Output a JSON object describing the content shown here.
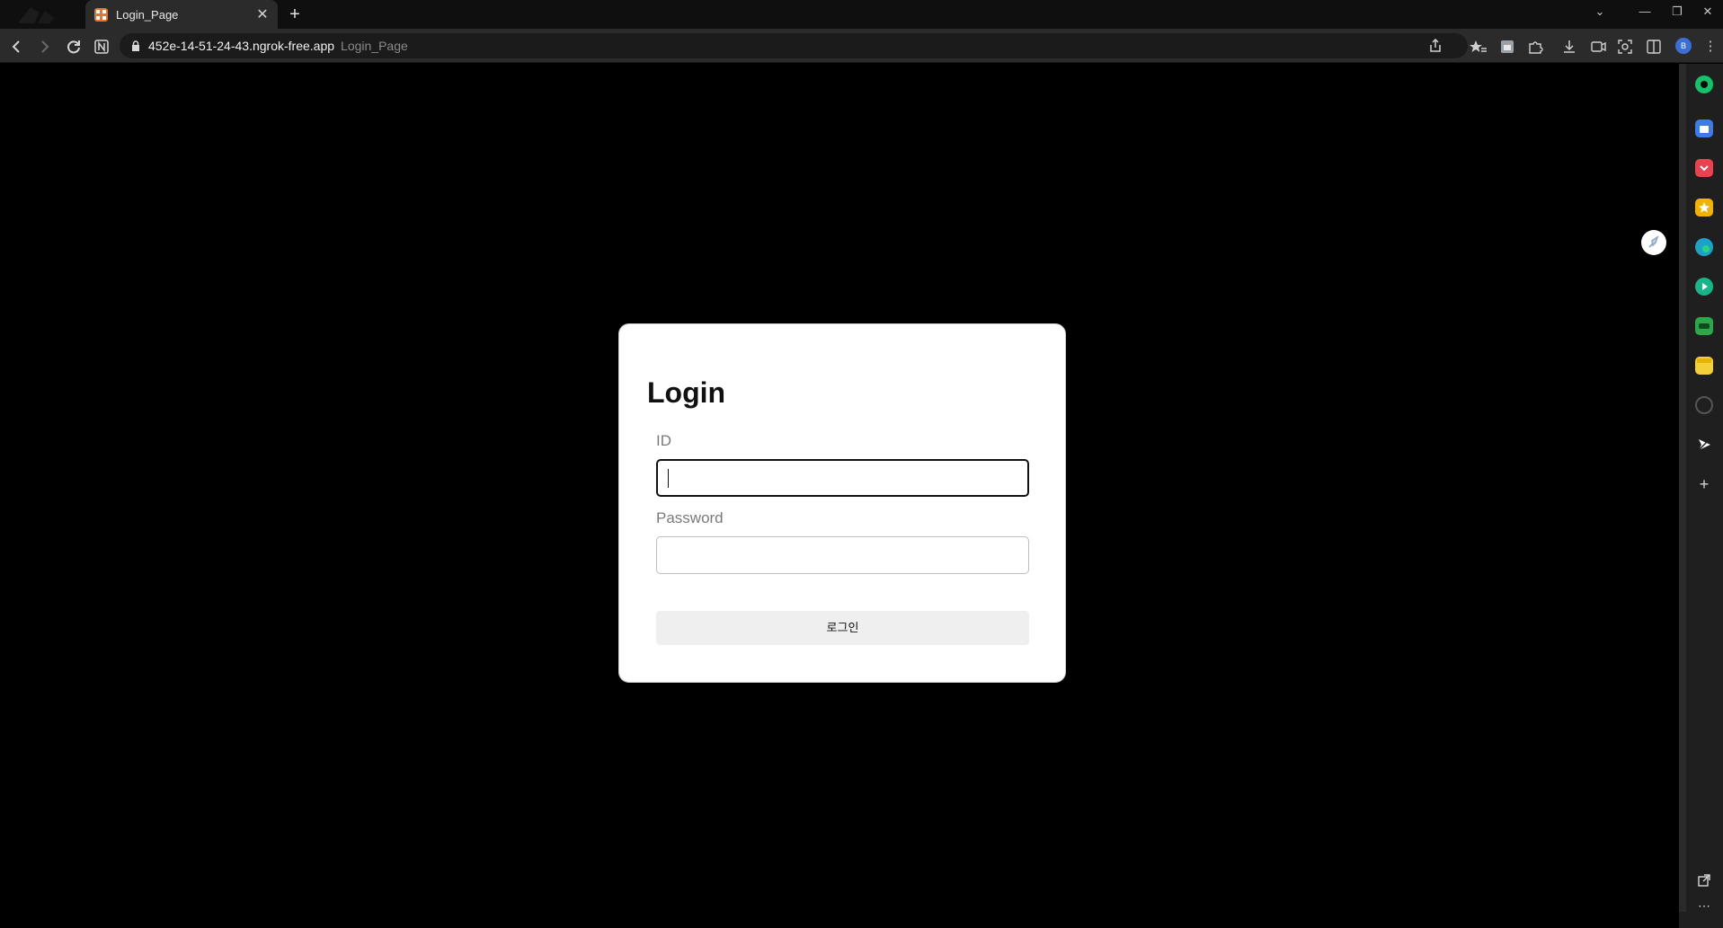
{
  "browser": {
    "tab": {
      "title": "Login_Page",
      "favicon": "grid-icon"
    },
    "address": {
      "host": "452e-14-51-24-43.ngrok-free.app",
      "page_title": "Login_Page"
    },
    "profile_initial": "B"
  },
  "login": {
    "heading": "Login",
    "id_label": "ID",
    "id_value": "",
    "password_label": "Password",
    "password_value": "",
    "submit_label": "로그인"
  },
  "sidebar": {
    "apps": [
      {
        "name": "app-circle-green",
        "color": "#13c26b"
      },
      {
        "name": "app-briefcase-blue",
        "color": "#3d7be8"
      },
      {
        "name": "app-pocket-red",
        "color": "#e8424f"
      },
      {
        "name": "app-star-yellow",
        "color": "#f0b400"
      },
      {
        "name": "app-edge-teal",
        "color": "#1aa3c9"
      },
      {
        "name": "app-play-green",
        "color": "#17b58a"
      },
      {
        "name": "app-game-green",
        "color": "#2aa84a"
      },
      {
        "name": "app-note-yellow",
        "color": "#f3cf3a"
      },
      {
        "name": "app-target-grey",
        "color": "#555555"
      },
      {
        "name": "app-send-white",
        "color": "#222222"
      }
    ]
  },
  "colors": {
    "page_bg": "#000000",
    "card_bg": "#ffffff",
    "chrome_bg": "#2b2b2b"
  }
}
